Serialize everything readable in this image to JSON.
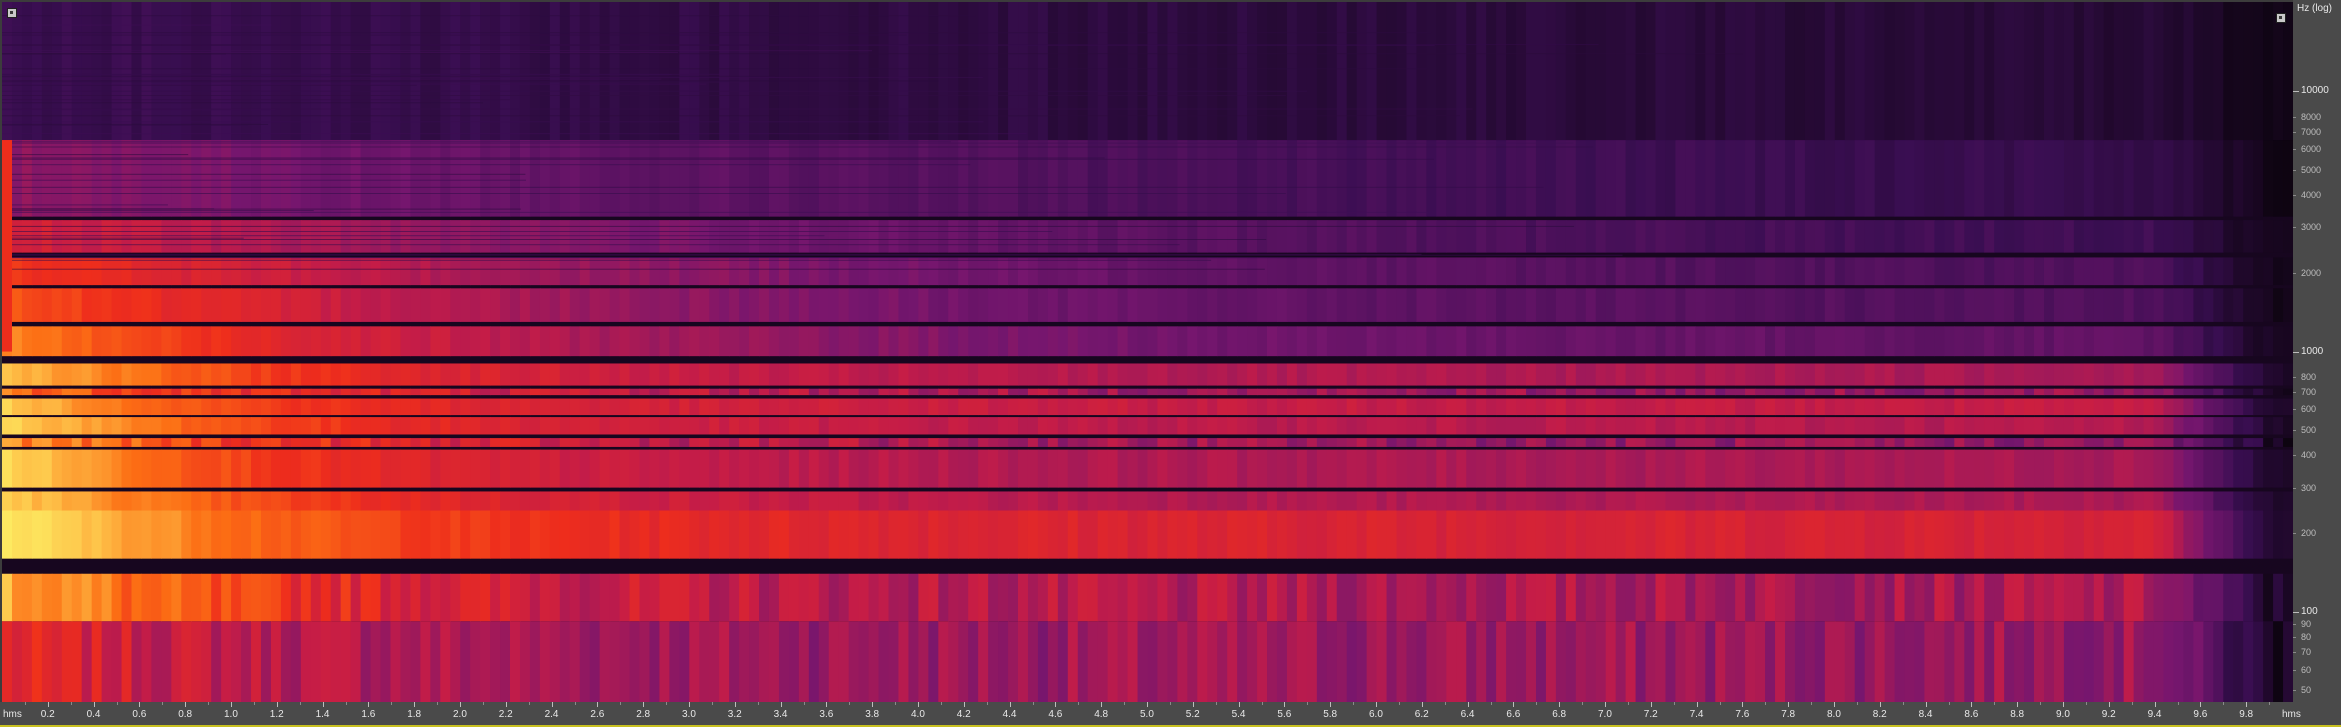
{
  "view": {
    "freq_axis_title": "Hz (log)",
    "time_unit_left": "hms",
    "time_unit_right": "hms",
    "freq_range_hz": [
      45,
      22050
    ],
    "time_range_s": [
      0,
      10.0
    ],
    "colormap": "inferno-style (black-purple-red-orange-yellow)"
  },
  "freq_labels": [
    {
      "hz": 10000,
      "text": "10000",
      "small": false
    },
    {
      "hz": 8000,
      "text": "8000",
      "small": true
    },
    {
      "hz": 7000,
      "text": "7000",
      "small": true
    },
    {
      "hz": 6000,
      "text": "6000",
      "small": true
    },
    {
      "hz": 5000,
      "text": "5000",
      "small": true
    },
    {
      "hz": 4000,
      "text": "4000",
      "small": true
    },
    {
      "hz": 3000,
      "text": "3000",
      "small": true
    },
    {
      "hz": 2000,
      "text": "2000",
      "small": true
    },
    {
      "hz": 1000,
      "text": "1000",
      "small": false
    },
    {
      "hz": 800,
      "text": "800",
      "small": true
    },
    {
      "hz": 700,
      "text": "700",
      "small": true
    },
    {
      "hz": 600,
      "text": "600",
      "small": true
    },
    {
      "hz": 500,
      "text": "500",
      "small": true
    },
    {
      "hz": 400,
      "text": "400",
      "small": true
    },
    {
      "hz": 300,
      "text": "300",
      "small": true
    },
    {
      "hz": 200,
      "text": "200",
      "small": true
    },
    {
      "hz": 100,
      "text": "100",
      "small": false
    },
    {
      "hz": 90,
      "text": "90",
      "small": true
    },
    {
      "hz": 80,
      "text": "80",
      "small": true
    },
    {
      "hz": 70,
      "text": "70",
      "small": true
    },
    {
      "hz": 60,
      "text": "60",
      "small": true
    },
    {
      "hz": 50,
      "text": "50",
      "small": true
    }
  ],
  "time_labels": [
    "0.2",
    "0.4",
    "0.6",
    "0.8",
    "1.0",
    "1.2",
    "1.4",
    "1.6",
    "1.8",
    "2.0",
    "2.2",
    "2.4",
    "2.6",
    "2.8",
    "3.0",
    "3.2",
    "3.4",
    "3.6",
    "3.8",
    "4.0",
    "4.2",
    "4.4",
    "4.6",
    "4.8",
    "5.0",
    "5.2",
    "5.4",
    "5.6",
    "5.8",
    "6.0",
    "6.2",
    "6.4",
    "6.6",
    "6.8",
    "7.0",
    "7.2",
    "7.4",
    "7.6",
    "7.8",
    "8.0",
    "8.2",
    "8.4",
    "8.6",
    "8.8",
    "9.0",
    "9.2",
    "9.4",
    "9.6",
    "9.8"
  ],
  "spectral_bands": [
    {
      "hz_low": 45,
      "hz_high": 92,
      "level_start": 0.58,
      "level_end": 0.42,
      "decay": 1.2,
      "striped": true
    },
    {
      "hz_low": 92,
      "hz_high": 140,
      "level_start": 0.86,
      "level_end": 0.45,
      "decay": 1.4,
      "striped": true
    },
    {
      "hz_low": 160,
      "hz_high": 245,
      "level_start": 0.97,
      "level_end": 0.55,
      "decay": 1.3,
      "striped": false
    },
    {
      "hz_low": 245,
      "hz_high": 290,
      "level_start": 0.9,
      "level_end": 0.45,
      "decay": 1.6,
      "striped": false
    },
    {
      "hz_low": 300,
      "hz_high": 420,
      "level_start": 0.93,
      "level_end": 0.45,
      "decay": 1.3,
      "striped": false
    },
    {
      "hz_low": 430,
      "hz_high": 465,
      "level_start": 0.8,
      "level_end": 0.4,
      "decay": 2.0,
      "striped": true
    },
    {
      "hz_low": 480,
      "hz_high": 560,
      "level_start": 0.92,
      "level_end": 0.47,
      "decay": 1.4,
      "striped": false
    },
    {
      "hz_low": 570,
      "hz_high": 660,
      "level_start": 0.9,
      "level_end": 0.5,
      "decay": 1.2,
      "striped": false
    },
    {
      "hz_low": 680,
      "hz_high": 720,
      "level_start": 0.75,
      "level_end": 0.4,
      "decay": 2.2,
      "striped": true
    },
    {
      "hz_low": 740,
      "hz_high": 900,
      "level_start": 0.88,
      "level_end": 0.45,
      "decay": 1.5,
      "striped": false
    },
    {
      "hz_low": 960,
      "hz_high": 1250,
      "level_start": 0.78,
      "level_end": 0.28,
      "decay": 2.4,
      "striped": false
    },
    {
      "hz_low": 1300,
      "hz_high": 1750,
      "level_start": 0.7,
      "level_end": 0.22,
      "decay": 3.0,
      "striped": false
    },
    {
      "hz_low": 1800,
      "hz_high": 2300,
      "level_start": 0.65,
      "level_end": 0.2,
      "decay": 3.5,
      "striped": false
    },
    {
      "hz_low": 2400,
      "hz_high": 3200,
      "level_start": 0.55,
      "level_end": 0.14,
      "decay": 4.5,
      "striped": false
    },
    {
      "hz_low": 3300,
      "hz_high": 6500,
      "level_start": 0.4,
      "level_end": 0.1,
      "decay": 6.0,
      "striped": false
    },
    {
      "hz_low": 6500,
      "hz_high": 22050,
      "level_start": 0.18,
      "level_end": 0.07,
      "decay": 8.0,
      "striped": false
    }
  ]
}
